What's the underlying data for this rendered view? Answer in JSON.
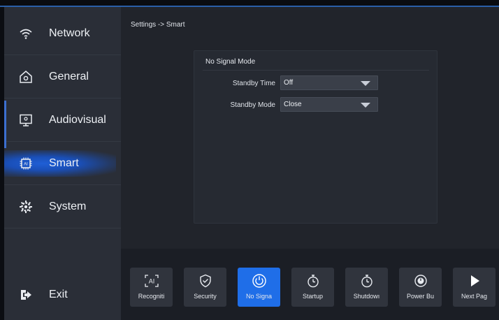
{
  "breadcrumb": "Settings -> Smart",
  "sidebar": {
    "items": [
      {
        "label": "Network",
        "icon": "wifi-icon"
      },
      {
        "label": "General",
        "icon": "home-gear-icon"
      },
      {
        "label": "Audiovisual",
        "icon": "monitor-icon"
      },
      {
        "label": "Smart",
        "icon": "ai-chip-icon",
        "active": true
      },
      {
        "label": "System",
        "icon": "gear-icon"
      }
    ],
    "exit_label": "Exit"
  },
  "panel": {
    "title": "No Signal Mode",
    "rows": [
      {
        "label": "Standby Time",
        "value": "Off"
      },
      {
        "label": "Standby Mode",
        "value": "Close"
      }
    ]
  },
  "bottom_tiles": [
    {
      "label": "Recogniti",
      "icon": "ai-scan-icon"
    },
    {
      "label": "Security",
      "icon": "shield-icon"
    },
    {
      "label": "No Signa",
      "icon": "power-icon",
      "active": true
    },
    {
      "label": "Startup",
      "icon": "timer-icon"
    },
    {
      "label": "Shutdowı",
      "icon": "timer-icon"
    },
    {
      "label": "Power Bu",
      "icon": "power-button-icon"
    },
    {
      "label": "Next Pag",
      "icon": "play-icon"
    }
  ],
  "colors": {
    "accent": "#1f6ee8",
    "sidebar_bg": "#2a2e37",
    "panel_bg": "#262a32"
  }
}
